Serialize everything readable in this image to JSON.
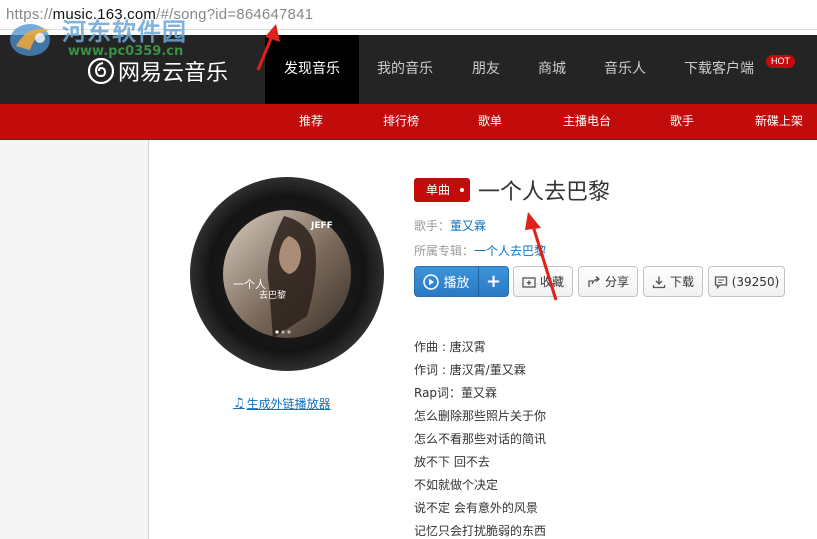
{
  "url": {
    "scheme": "https://",
    "host": "music.163.com",
    "path": "/#/song?id=864647841"
  },
  "watermark": {
    "line1": "河东软件园",
    "line2": "www.pc0359.cn"
  },
  "brand": {
    "name": "网易云音乐"
  },
  "nav": {
    "items": [
      "发现音乐",
      "我的音乐",
      "朋友",
      "商城",
      "音乐人",
      "下载客户端"
    ],
    "active": "发现音乐",
    "hot_badge": "HOT"
  },
  "subnav": {
    "items": [
      "推荐",
      "排行榜",
      "歌单",
      "主播电台",
      "歌手",
      "新碟上架"
    ]
  },
  "song": {
    "tag": "单曲",
    "title": "一个人去巴黎",
    "artist_label": "歌手：",
    "artist": "董又霖",
    "album_label": "所属专辑：",
    "album": "一个人去巴黎",
    "cover_text": {
      "brand": "JEFF",
      "title_a": "一个人",
      "title_b": "去巴黎"
    }
  },
  "actions": {
    "play": "播放",
    "add": "+",
    "collect": "收藏",
    "share": "分享",
    "download": "下载",
    "comments": "(39250)"
  },
  "generate_link": "生成外链播放器",
  "lyrics": [
    "作曲 : 唐汉霄",
    "作词 : 唐汉霄/董又霖",
    "Rap词：董又霖",
    "怎么删除那些照片关于你",
    "怎么不看那些对话的简讯",
    "放不下 回不去",
    "不如就做个决定",
    "说不定 会有意外的风景",
    "记忆只会打扰脆弱的东西"
  ],
  "colors": {
    "brand_red": "#c20c0c",
    "nav_bg": "#242424",
    "link_blue": "#0c73c2",
    "play_blue": "#2a79c3",
    "arrow_red": "#e0201a"
  }
}
